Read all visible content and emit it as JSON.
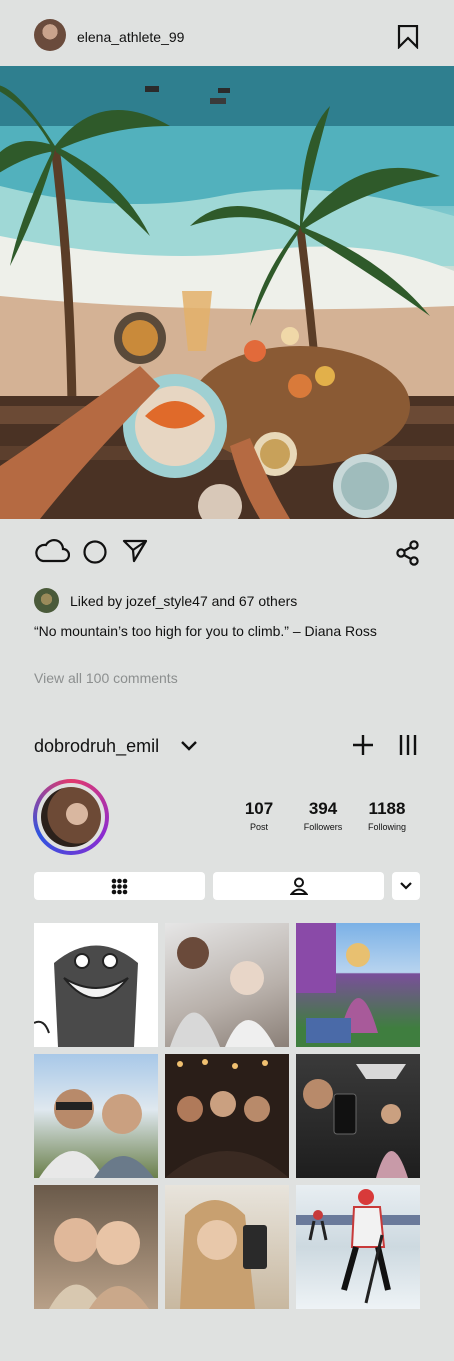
{
  "post": {
    "author_username": "elena_athlete_99",
    "liked_by_text": "Liked by jozef_style47 and 67 others",
    "caption": "“No mountain’s too high for you to climb.” – Diana Ross",
    "view_comments": "View all 100 comments"
  },
  "profile": {
    "username": "dobrodruh_emil",
    "stats": [
      {
        "value": "107",
        "label": "Post"
      },
      {
        "value": "394",
        "label": "Followers"
      },
      {
        "value": "1188",
        "label": "Following"
      }
    ]
  },
  "icons": {
    "bookmark": "bookmark-icon",
    "like": "cloud-icon",
    "comment": "circle-icon",
    "send": "send-icon",
    "share": "share-icon",
    "add": "plus-icon",
    "menu": "menu-icon",
    "grid": "grid-icon",
    "tagged": "person-icon",
    "expand": "chevron-down-icon"
  }
}
